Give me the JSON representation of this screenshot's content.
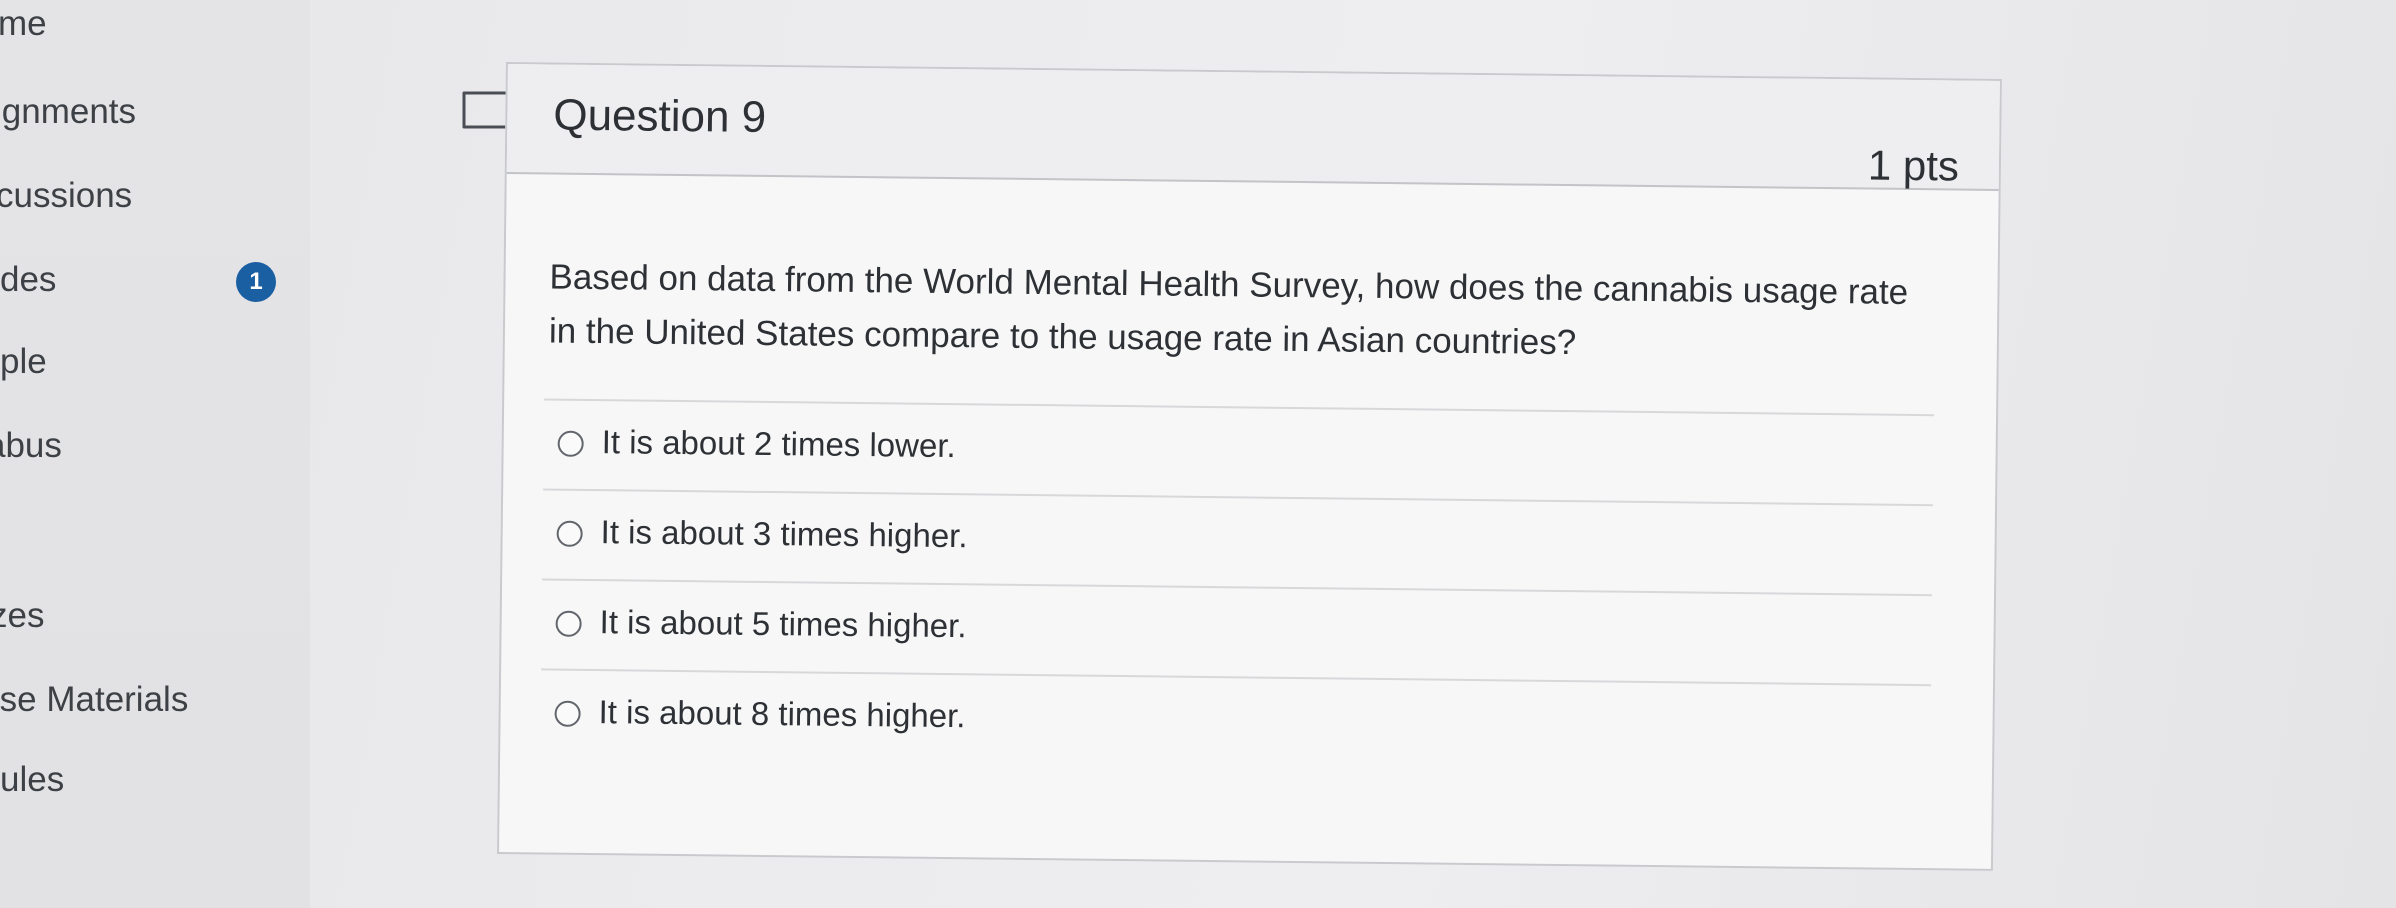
{
  "nav": {
    "items": [
      {
        "label": "me"
      },
      {
        "label": "ignments"
      },
      {
        "label": "cussions"
      },
      {
        "label": "des"
      },
      {
        "label": "ple"
      },
      {
        "label": "abus"
      },
      {
        "label": "zes"
      },
      {
        "label": "rse Materials"
      },
      {
        "label": "ules"
      }
    ],
    "grades_badge": "1"
  },
  "question": {
    "title": "Question 9",
    "points": "1 pts",
    "text": "Based on data from the World Mental Health Survey, how does the cannabis usage rate in the United States compare to the usage rate in Asian countries?",
    "answers": [
      {
        "label": "It is about 2 times lower."
      },
      {
        "label": "It is about 3 times higher."
      },
      {
        "label": "It is about 5 times higher."
      },
      {
        "label": "It is about 8 times higher."
      }
    ]
  },
  "icons": {
    "flag": "bookmark-flag-icon",
    "radio": "radio-unselected-icon"
  },
  "colors": {
    "badge": "#1b5fa3",
    "text": "#2d3034",
    "header_bg": "#eeeef0"
  }
}
